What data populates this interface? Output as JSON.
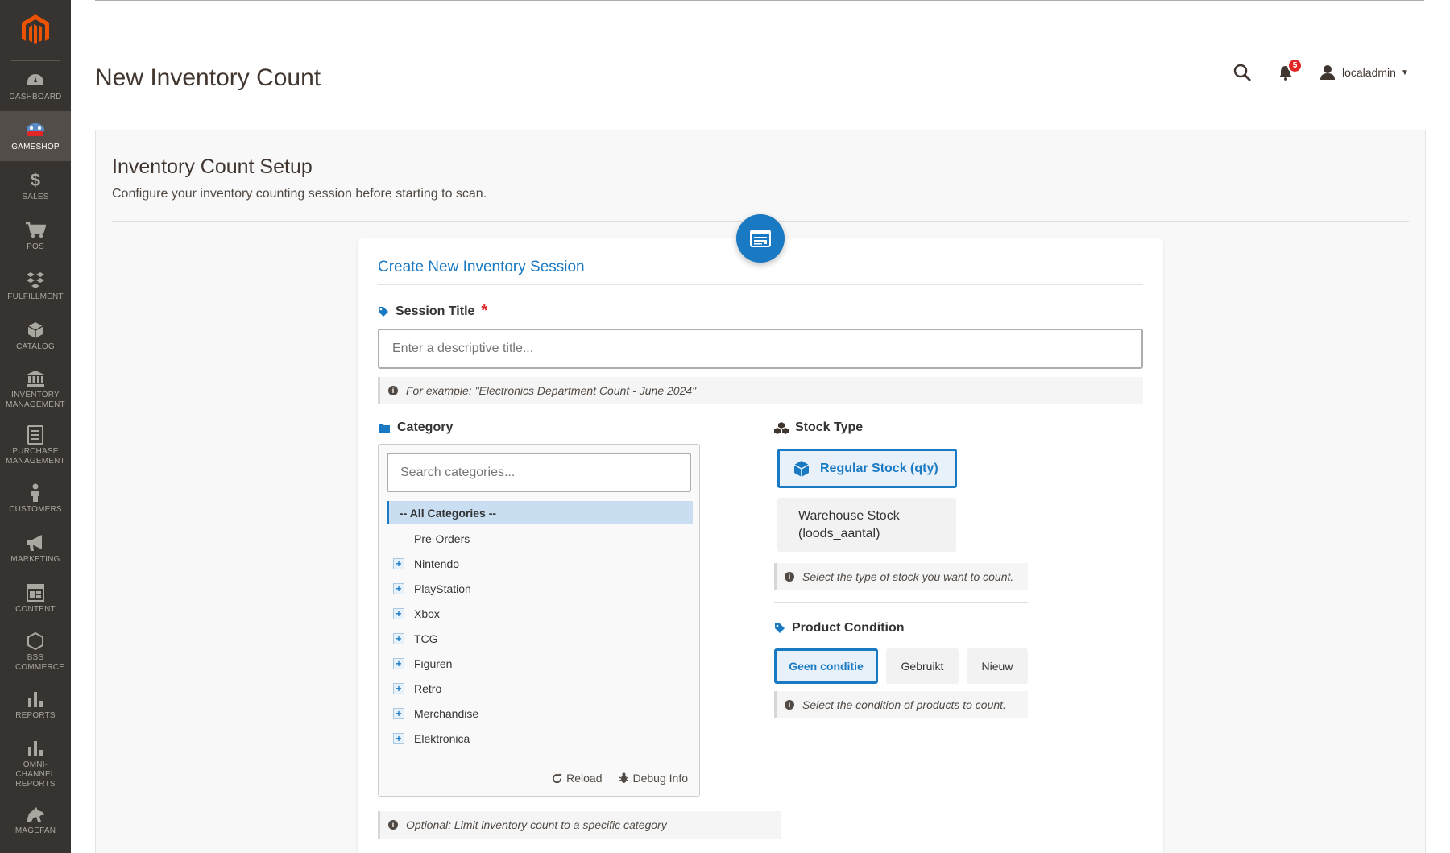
{
  "sidebar": {
    "items": [
      {
        "label": "DASHBOARD",
        "icon": "dashboard-icon"
      },
      {
        "label": "GAMESHOP",
        "icon": "gameshop-icon",
        "active": true
      },
      {
        "label": "SALES",
        "icon": "dollar-icon"
      },
      {
        "label": "POS",
        "icon": "cart-icon"
      },
      {
        "label": "FULFILLMENT",
        "icon": "dropbox-icon"
      },
      {
        "label": "CATALOG",
        "icon": "cube-icon"
      },
      {
        "label": "INVENTORY MANAGEMENT",
        "icon": "bank-icon"
      },
      {
        "label": "PURCHASE MANAGEMENT",
        "icon": "document-icon"
      },
      {
        "label": "CUSTOMERS",
        "icon": "person-icon"
      },
      {
        "label": "MARKETING",
        "icon": "megaphone-icon"
      },
      {
        "label": "CONTENT",
        "icon": "layout-icon"
      },
      {
        "label": "BSS COMMERCE",
        "icon": "hexagon-icon"
      },
      {
        "label": "REPORTS",
        "icon": "bar-chart-icon"
      },
      {
        "label": "OMNI-CHANNEL REPORTS",
        "icon": "bar-chart-icon"
      },
      {
        "label": "MAGEFAN",
        "icon": "magefan-icon"
      }
    ]
  },
  "header": {
    "title": "New Inventory Count",
    "notification_count": "5",
    "username": "localadmin"
  },
  "setup": {
    "title": "Inventory Count Setup",
    "description": "Configure your inventory counting session before starting to scan."
  },
  "card": {
    "title": "Create New Inventory Session"
  },
  "session_title": {
    "label": "Session Title",
    "required_mark": "*",
    "placeholder": "Enter a descriptive title...",
    "value": "",
    "hint": "For example: \"Electronics Department Count - June 2024\""
  },
  "category": {
    "label": "Category",
    "search_placeholder": "Search categories...",
    "items": [
      {
        "label": "-- All Categories --",
        "selected": true,
        "expandable": false
      },
      {
        "label": "Pre-Orders",
        "expandable": false
      },
      {
        "label": "Nintendo",
        "expandable": true
      },
      {
        "label": "PlayStation",
        "expandable": true
      },
      {
        "label": "Xbox",
        "expandable": true
      },
      {
        "label": "TCG",
        "expandable": true
      },
      {
        "label": "Figuren",
        "expandable": true
      },
      {
        "label": "Retro",
        "expandable": true
      },
      {
        "label": "Merchandise",
        "expandable": true
      },
      {
        "label": "Elektronica",
        "expandable": true
      }
    ],
    "reload_label": "Reload",
    "debug_label": "Debug Info",
    "hint": "Optional: Limit inventory count to a specific category"
  },
  "stock_type": {
    "label": "Stock Type",
    "options": [
      "Regular Stock (qty)",
      "Warehouse Stock (loods_aantal)"
    ],
    "selected": "Regular Stock (qty)",
    "hint": "Select the type of stock you want to count."
  },
  "condition": {
    "label": "Product Condition",
    "options": [
      "Geen conditie",
      "Gebruikt",
      "Nieuw"
    ],
    "selected": "Geen conditie",
    "hint": "Select the condition of products to count."
  },
  "colors": {
    "accent": "#1979c3",
    "sidebar_bg": "#373330",
    "required": "#e22626",
    "logo": "#eb5202"
  }
}
